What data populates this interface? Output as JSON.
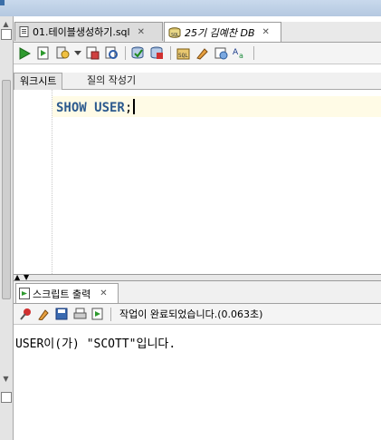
{
  "editor_tabs": [
    {
      "label": "01.테이블생성하기.sql",
      "icon": "sql-file-icon"
    },
    {
      "label": "25기 김예찬 DB",
      "icon": "db-connection-icon"
    }
  ],
  "toolbar_icons": [
    "run-statement-icon",
    "run-script-icon",
    "explain-plan-icon",
    "dropdown-arrow-icon",
    "autotrace-icon",
    "sql-tuning-icon",
    "commit-icon",
    "rollback-icon",
    "sql-history-icon",
    "clear-icon",
    "format-icon",
    "case-toggle-icon"
  ],
  "subtabs": {
    "worksheet": "워크시트",
    "query_builder": "질의 작성기"
  },
  "editor": {
    "keyword": "SHOW USER",
    "terminator": ";"
  },
  "output": {
    "tab_label": "스크립트 출력",
    "status": "작업이 완료되었습니다.(0.063초)",
    "result": "USER이(가) \"SCOTT\"입니다."
  },
  "colors": {
    "keyword": "#2c5a8e",
    "current_line": "#fffbe6",
    "run_green": "#2e9a2e"
  }
}
